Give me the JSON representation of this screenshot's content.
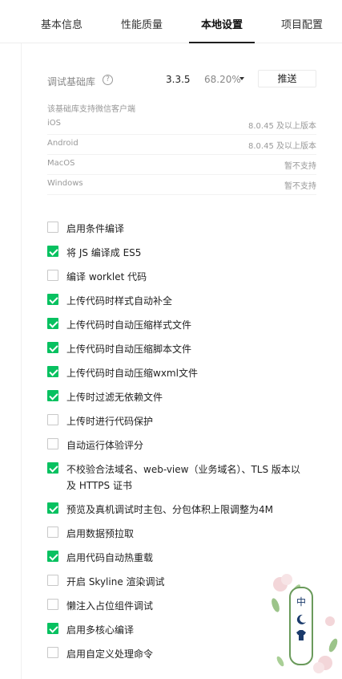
{
  "tabs": [
    {
      "label": "基本信息"
    },
    {
      "label": "性能质量"
    },
    {
      "label": "本地设置"
    },
    {
      "label": "项目配置"
    }
  ],
  "debug_lib": {
    "label": "调试基础库",
    "version": "3.3.5",
    "percent": "68.20%",
    "push_label": "推送"
  },
  "support": {
    "title": "该基础库支持微信客户端",
    "rows": [
      {
        "name": "iOS",
        "value": "8.0.45 及以上版本"
      },
      {
        "name": "Android",
        "value": "8.0.45 及以上版本"
      },
      {
        "name": "MacOS",
        "value": "暂不支持"
      },
      {
        "name": "Windows",
        "value": "暂不支持"
      }
    ]
  },
  "options": [
    {
      "label": "启用条件编译",
      "checked": false
    },
    {
      "label": "将 JS 编译成 ES5",
      "checked": true
    },
    {
      "label": "编译 worklet 代码",
      "checked": false
    },
    {
      "label": "上传代码时样式自动补全",
      "checked": true
    },
    {
      "label": "上传代码时自动压缩样式文件",
      "checked": true
    },
    {
      "label": "上传代码时自动压缩脚本文件",
      "checked": true
    },
    {
      "label": "上传代码时自动压缩wxml文件",
      "checked": true
    },
    {
      "label": "上传时过滤无依赖文件",
      "checked": true
    },
    {
      "label": "上传时进行代码保护",
      "checked": false
    },
    {
      "label": "自动运行体验评分",
      "checked": false
    },
    {
      "label": "不校验合法域名、web-view（业务域名）、TLS 版本以及 HTTPS 证书",
      "checked": true
    },
    {
      "label": "预览及真机调试时主包、分包体积上限调整为4M",
      "checked": true
    },
    {
      "label": "启用数据预拉取",
      "checked": false
    },
    {
      "label": "启用代码自动热重载",
      "checked": true
    },
    {
      "label": "开启 Skyline 渲染调试",
      "checked": false
    },
    {
      "label": "懒注入占位组件调试",
      "checked": false
    },
    {
      "label": "启用多核心编译",
      "checked": true
    },
    {
      "label": "启用自定义处理命令",
      "checked": false
    }
  ],
  "sticker": {
    "text": "中",
    "icons": [
      "moon-icon",
      "shirt-icon"
    ],
    "accent": "#6a9a5b"
  },
  "colors": {
    "check_green": "#07c160"
  }
}
